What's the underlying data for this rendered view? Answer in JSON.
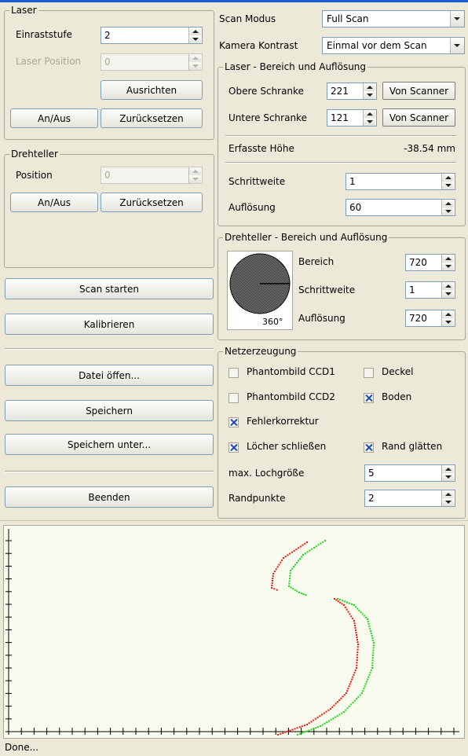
{
  "laser": {
    "legend": "Laser",
    "einraststufe_label": "Einraststufe",
    "einraststufe_value": "2",
    "position_label": "Laser Position",
    "position_value": "0",
    "ausrichten": "Ausrichten",
    "anaus": "An/Aus",
    "zuruecksetzen": "Zurücksetzen"
  },
  "drehteller": {
    "legend": "Drehteller",
    "position_label": "Position",
    "position_value": "0",
    "anaus": "An/Aus",
    "zuruecksetzen": "Zurücksetzen"
  },
  "actions": {
    "scan_starten": "Scan starten",
    "kalibrieren": "Kalibrieren",
    "datei_oeffnen": "Datei öffen...",
    "speichern": "Speichern",
    "speichern_unter": "Speichern unter...",
    "beenden": "Beenden"
  },
  "scan": {
    "modus_label": "Scan Modus",
    "modus_value": "Full Scan",
    "kontrast_label": "Kamera Kontrast",
    "kontrast_value": "Einmal vor dem Scan"
  },
  "laser_range": {
    "legend": "Laser - Bereich und Auflösung",
    "obere_label": "Obere Schranke",
    "obere_value": "221",
    "untere_label": "Untere Schranke",
    "untere_value": "121",
    "von_scanner": "Von Scanner",
    "hoehe_label": "Erfasste Höhe",
    "hoehe_value": "-38.54 mm",
    "schrittweite_label": "Schrittweite",
    "schrittweite_value": "1",
    "aufloesung_label": "Auflösung",
    "aufloesung_value": "60"
  },
  "dreh_range": {
    "legend": "Drehteller - Bereich und Auflösung",
    "dial_label": "360°",
    "bereich_label": "Bereich",
    "bereich_value": "720",
    "schrittweite_label": "Schrittweite",
    "schrittweite_value": "1",
    "aufloesung_label": "Auflösung",
    "aufloesung_value": "720"
  },
  "netz": {
    "legend": "Netzerzeugung",
    "phantom1": {
      "label": "Phantombild CCD1",
      "checked": false
    },
    "deckel": {
      "label": "Deckel",
      "checked": false
    },
    "phantom2": {
      "label": "Phantombild CCD2",
      "checked": false
    },
    "boden": {
      "label": "Boden",
      "checked": true
    },
    "fehler": {
      "label": "Fehlerkorrektur",
      "checked": true
    },
    "loecher": {
      "label": "Löcher schließen",
      "checked": true
    },
    "rand": {
      "label": "Rand glätten",
      "checked": true
    },
    "lochgroesse_label": "max. Lochgröße",
    "lochgroesse_value": "5",
    "randpunkte_label": "Randpunkte",
    "randpunkte_value": "2"
  },
  "status": "Done...",
  "colors": {
    "red_profile": "#e8190f",
    "green_profile": "#1fd818"
  }
}
